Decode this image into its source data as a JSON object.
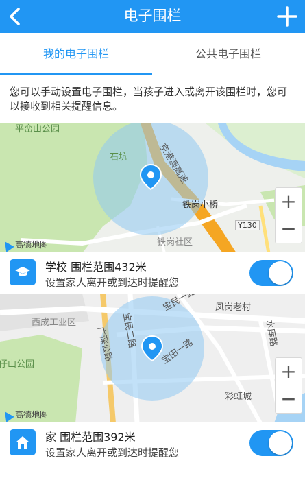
{
  "header": {
    "title": "电子围栏",
    "back_icon": "back-arrow-icon",
    "add_icon": "plus-icon"
  },
  "tabs": [
    {
      "label": "我的电子围栏",
      "active": true
    },
    {
      "label": "公共电子围栏",
      "active": false
    }
  ],
  "description": "您可以手动设置电子围栏，当孩子进入或离开该围栏时，您可以接收到相关提醒信息。",
  "maps": [
    {
      "labels": {
        "park": "平峦山公园",
        "stone": "石坑",
        "highway": "京港澳高速",
        "bridge": "铁岗小桥",
        "road": "Y130",
        "community": "铁岗社区"
      },
      "logo": "高德地图",
      "zoom": {
        "plus": "+",
        "minus": "−"
      }
    },
    {
      "labels": {
        "industrial": "西成工业区",
        "park": "仔山公园",
        "road_guangshen": "广深公路",
        "road_baomin": "宝民二路",
        "road_baotian": "宝田一路",
        "village": "凤岗老村",
        "shui": "水库路",
        "rainbow": "彩虹城",
        "top_road": "宝民一路"
      },
      "logo": "高德地图",
      "zoom": {
        "plus": "+",
        "minus": "−"
      }
    }
  ],
  "fences": [
    {
      "icon": "graduation-cap-icon",
      "name": "学校",
      "range": "围栏范围432米",
      "subtitle": "设置家人离开或到达时提醒您",
      "enabled": true
    },
    {
      "icon": "home-icon",
      "name": "家",
      "range": "围栏范围392米",
      "subtitle": "设置家人离开或到达时提醒您",
      "enabled": true
    }
  ],
  "colors": {
    "primary": "#2196f3",
    "map_green": "#c9e6b0",
    "highway": "#f5a623",
    "water": "#a6d3f5"
  }
}
